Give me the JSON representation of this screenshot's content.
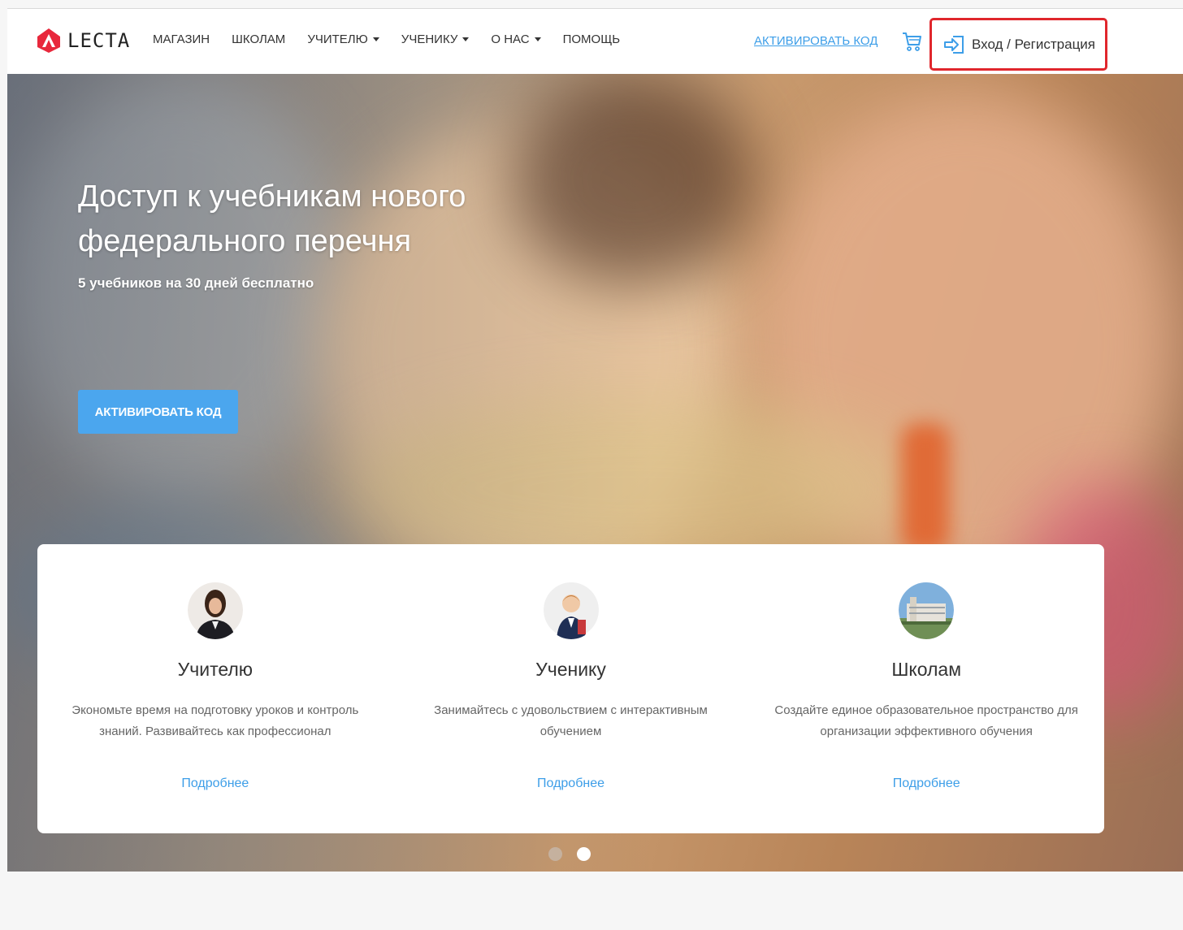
{
  "header": {
    "logo_text": "LECTA",
    "nav": [
      {
        "label": "МАГАЗИН",
        "dropdown": false
      },
      {
        "label": "ШКОЛАМ",
        "dropdown": false
      },
      {
        "label": "УЧИТЕЛЮ",
        "dropdown": true
      },
      {
        "label": "УЧЕНИКУ",
        "dropdown": true
      },
      {
        "label": "О НАС",
        "dropdown": true
      },
      {
        "label": "ПОМОЩЬ",
        "dropdown": false
      }
    ],
    "activate_code": "АКТИВИРОВАТЬ КОД",
    "cart_icon": "cart-icon",
    "login_label": "Вход / Регистрация",
    "login_icon": "login-icon",
    "highlight_color": "#e0262c"
  },
  "hero": {
    "title": "Доступ к учебникам нового федерального перечня",
    "subtitle": "5 учебников на 30 дней бесплатно",
    "button_label": "АКТИВИРОВАТЬ КОД",
    "button_color": "#4ba6ee"
  },
  "cards": [
    {
      "title": "Учителю",
      "text": "Экономьте время на подготовку уроков и контроль знаний. Развивайтесь как профессионал",
      "link": "Подробнее",
      "image": "teacher-photo"
    },
    {
      "title": "Ученику",
      "text": "Занимайтесь с удовольствием с интерактивным обучением",
      "link": "Подробнее",
      "image": "student-photo"
    },
    {
      "title": "Школам",
      "text": "Создайте единое образовательное пространство для организации эффективного обучения",
      "link": "Подробнее",
      "image": "school-photo"
    }
  ],
  "carousel": {
    "slides": 2,
    "active_slide": 2
  },
  "colors": {
    "accent": "#3d9ee8",
    "logo_red": "#e8283c"
  }
}
